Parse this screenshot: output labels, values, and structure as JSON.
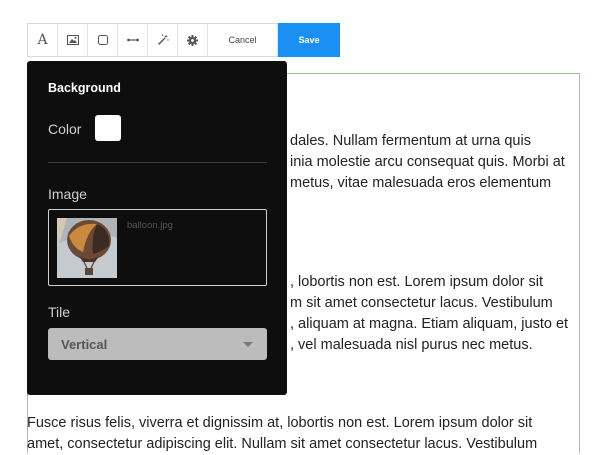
{
  "toolbar": {
    "text_tool_glyph": "A",
    "cancel_label": "Cancel",
    "save_label": "Save",
    "tools": [
      "text-icon",
      "image-icon",
      "shape-icon",
      "link-icon",
      "magic-wand-icon",
      "gear-icon"
    ],
    "accent_color": "#1a90f5"
  },
  "content": {
    "paragraphs": [
      {
        "lines": [
          "dales. Nullam fermentum at urna quis",
          "inia molestie arcu consequat quis. Morbi at",
          "metus, vitae malesuada eros elementum"
        ]
      },
      {
        "lines": [
          ", lobortis non est. Lorem ipsum dolor sit",
          "m sit amet consectetur lacus. Vestibulum",
          ", aliquam at magna. Etiam aliquam, justo et",
          ", vel malesuada nisl purus nec metus."
        ]
      },
      {
        "lines": [
          "Fusce risus felis, viverra et dignissim at, lobortis non est. Lorem ipsum dolor sit",
          "amet, consectetur adipiscing elit. Nullam sit amet consectetur lacus. Vestibulum"
        ]
      }
    ],
    "border_color": "#7ed67e"
  },
  "panel": {
    "title": "Background",
    "color_label": "Color",
    "color_value": "#ffffff",
    "image_label": "Image",
    "image_file": "balloon.jpg",
    "tile_label": "Tile",
    "tile_value": "Vertical"
  }
}
